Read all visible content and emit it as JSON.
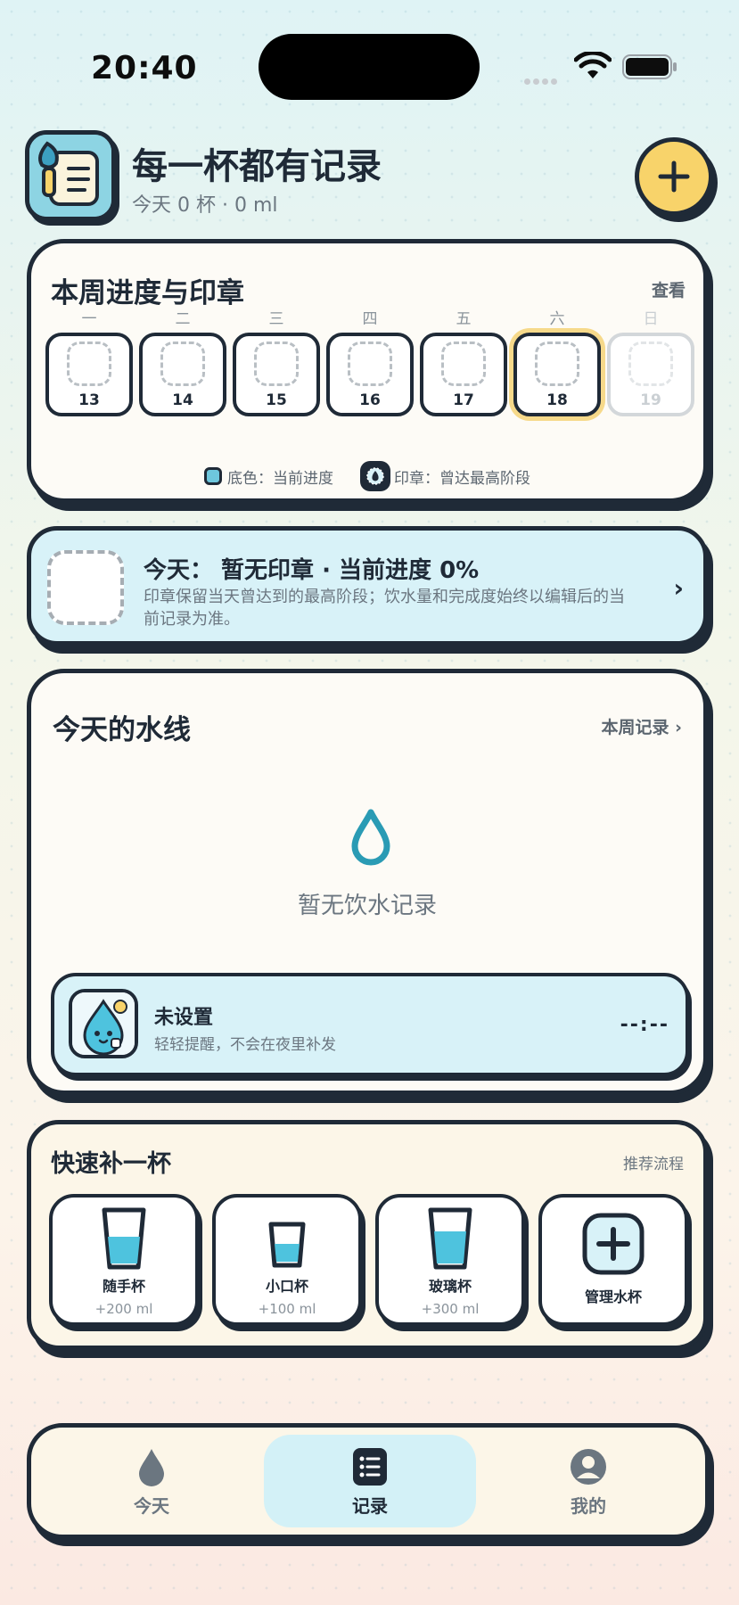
{
  "status_bar": {
    "time": "20:40"
  },
  "header": {
    "title": "每一杯都有记录",
    "subtitle": "今天 0 杯 · 0 ml",
    "add_icon": "plus-icon"
  },
  "week": {
    "title": "本周进度与印章",
    "view_label": "查看",
    "days": [
      {
        "label": "一",
        "date": "13"
      },
      {
        "label": "二",
        "date": "14"
      },
      {
        "label": "三",
        "date": "15"
      },
      {
        "label": "四",
        "date": "16"
      },
      {
        "label": "五",
        "date": "17"
      },
      {
        "label": "六",
        "date": "18"
      },
      {
        "label": "日",
        "date": "19"
      }
    ],
    "legend_base": "底色：当前进度",
    "legend_stamp": "印章：曾达最高阶段"
  },
  "today": {
    "title": "今天：  暂无印章 · 当前进度 0%",
    "desc": "印章保留当天曾达到的最高阶段；饮水量和完成度始终以编辑后的当前记录为准。"
  },
  "waterline": {
    "title": "今天的水线",
    "link": "本周记录",
    "empty_text": "暂无饮水记录",
    "reminder": {
      "title": "未设置",
      "subtitle": "轻轻提醒，不会在夜里补发",
      "time": "--:--"
    }
  },
  "quick": {
    "title": "快速补一杯",
    "link": "推荐流程",
    "cups": [
      {
        "name": "随手杯",
        "amount": "+200 ml"
      },
      {
        "name": "小口杯",
        "amount": "+100 ml"
      },
      {
        "name": "玻璃杯",
        "amount": "+300 ml"
      }
    ],
    "manage_label": "管理水杯"
  },
  "tabs": [
    {
      "label": "今天",
      "icon": "drop-icon"
    },
    {
      "label": "记录",
      "icon": "list-icon"
    },
    {
      "label": "我的",
      "icon": "profile-icon"
    }
  ],
  "colors": {
    "accent": "#f8d36a",
    "water": "#4ec3de",
    "outline": "#1f2a37"
  }
}
